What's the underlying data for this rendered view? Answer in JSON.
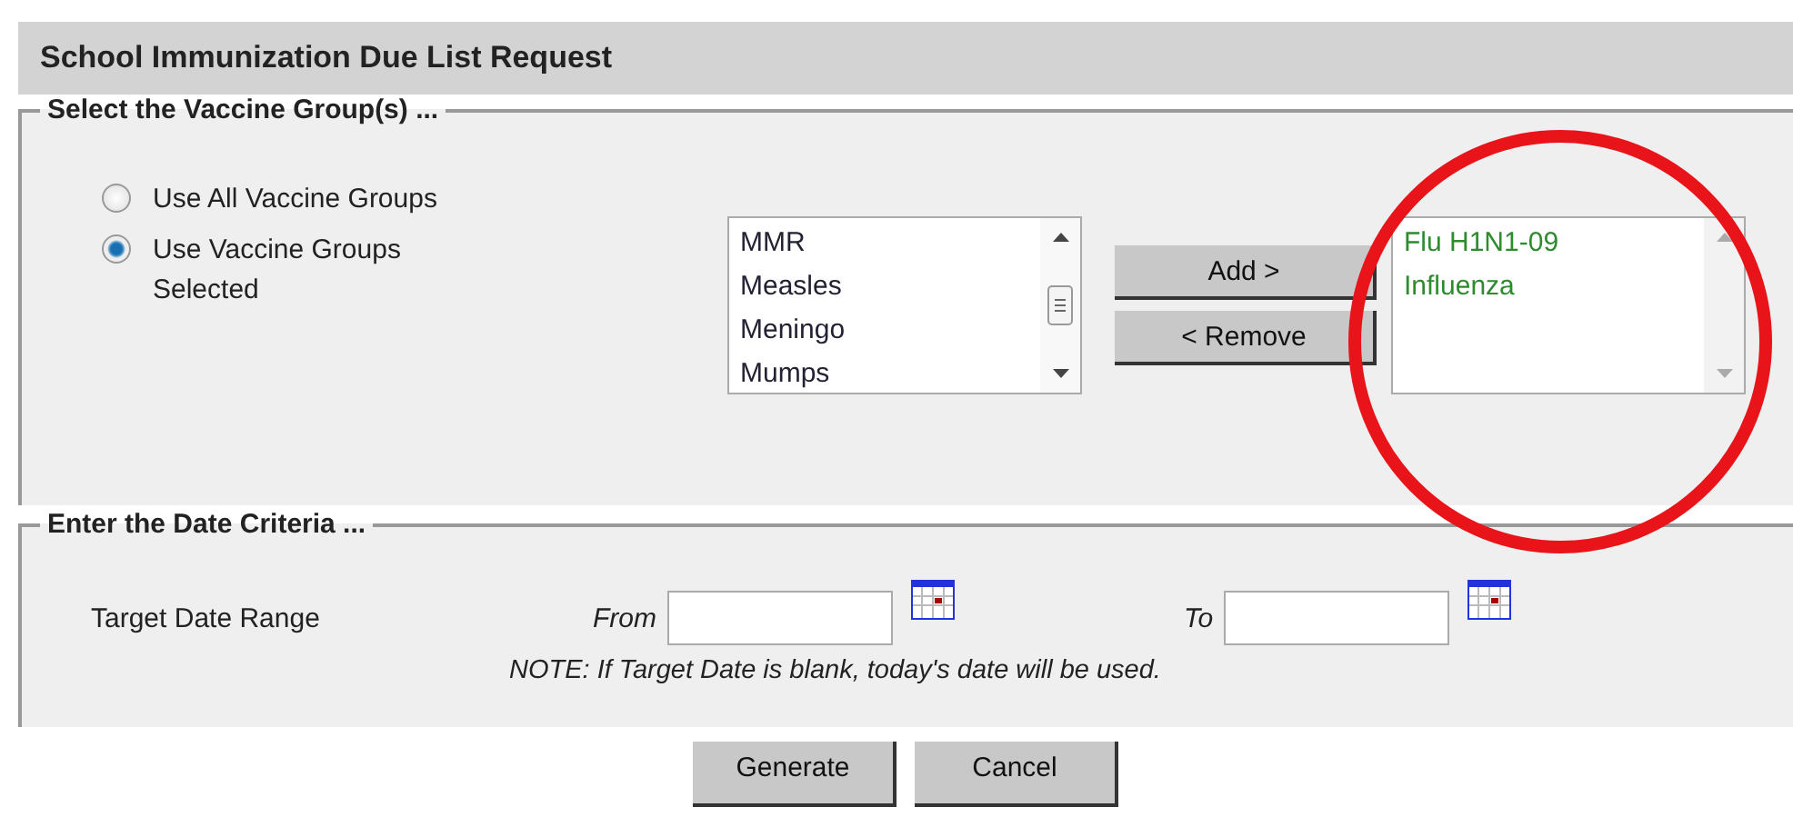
{
  "title": "School Immunization Due List Request",
  "vaccine_section": {
    "legend": "Select the Vaccine Group(s) ...",
    "options": [
      {
        "label": "Use All Vaccine Groups",
        "selected": false
      },
      {
        "label": "Use Vaccine Groups Selected",
        "selected": true
      }
    ],
    "available": [
      "MMR",
      "Measles",
      "Meningo",
      "Mumps"
    ],
    "add_button": "Add >",
    "remove_button": "< Remove",
    "chosen": [
      "Flu H1N1-09",
      "Influenza"
    ]
  },
  "date_section": {
    "legend": "Enter the Date Criteria ...",
    "label": "Target Date Range",
    "from_label": "From",
    "to_label": "To",
    "note": "NOTE: If Target Date is blank, today's date will be used."
  },
  "buttons": [
    "Generate",
    "Cancel"
  ]
}
